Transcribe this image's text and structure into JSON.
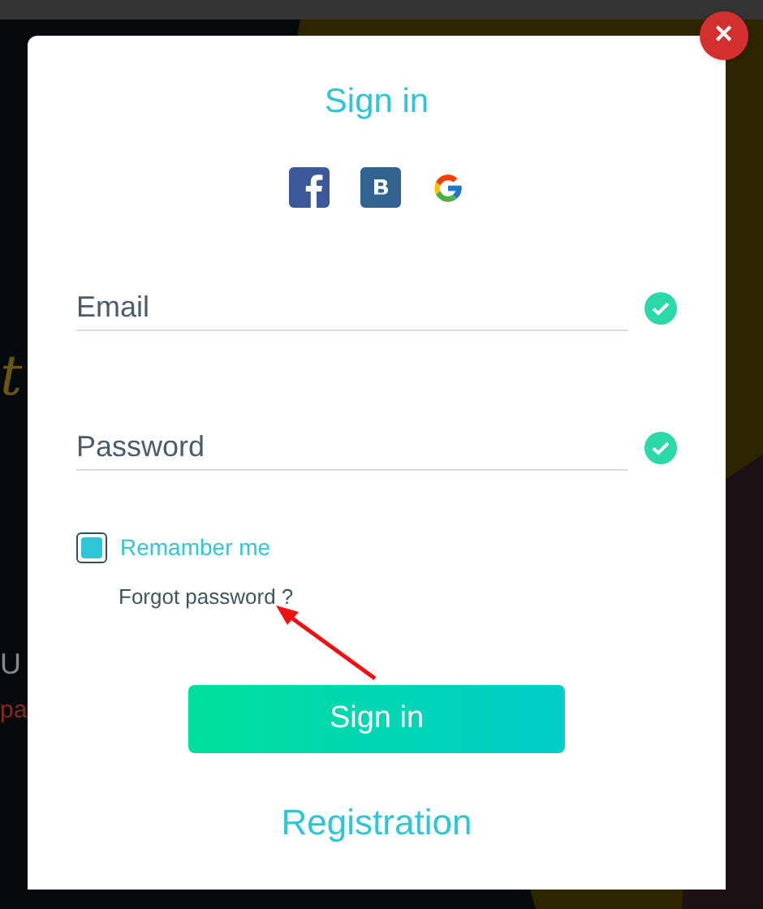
{
  "background": {
    "fragments": [
      {
        "kind": "script",
        "text": "t"
      },
      {
        "kind": "plain",
        "text": "U"
      },
      {
        "kind": "accent",
        "text": "pa"
      }
    ]
  },
  "dialog": {
    "title": "Sign in",
    "social": [
      {
        "kind": "facebook"
      },
      {
        "kind": "vk"
      },
      {
        "kind": "google"
      }
    ],
    "fields": [
      {
        "placeholder": "Email",
        "valid": true
      },
      {
        "placeholder": "Password",
        "valid": true
      }
    ],
    "remember": {
      "label": "Remamber me",
      "checked": true
    },
    "forgot": "Forgot password ?",
    "submit": "Sign in",
    "register": "Registration",
    "close": "✕"
  },
  "annotation": {
    "kind": "arrow"
  }
}
